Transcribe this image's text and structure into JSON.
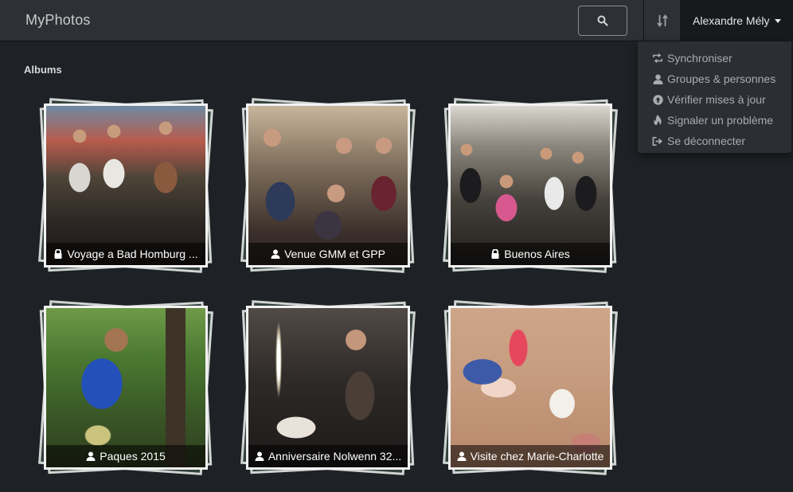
{
  "navbar": {
    "brand": "MyPhotos",
    "search_icon": "search-icon",
    "sort_icon": "sort-icon",
    "user_name": "Alexandre Mély"
  },
  "dropdown": {
    "items": [
      {
        "label": "Synchroniser",
        "icon": "sync-icon"
      },
      {
        "label": "Groupes & personnes",
        "icon": "user-icon"
      },
      {
        "label": "Vérifier mises à jour",
        "icon": "upload-circle-icon"
      },
      {
        "label": "Signaler un problème",
        "icon": "fire-icon"
      },
      {
        "label": "Se déconnecter",
        "icon": "logout-icon"
      }
    ]
  },
  "section_title": "Albums",
  "albums": [
    {
      "title": "Voyage a Bad Homburg ...",
      "icon": "lock-icon"
    },
    {
      "title": "Venue GMM et GPP",
      "icon": "user-icon"
    },
    {
      "title": "Buenos Aires",
      "icon": "lock-icon"
    },
    {
      "title": "Paques 2015",
      "icon": "user-icon"
    },
    {
      "title": "Anniversaire Nolwenn 32...",
      "icon": "user-icon"
    },
    {
      "title": "Visite chez Marie-Charlotte",
      "icon": "user-icon"
    }
  ],
  "colors": {
    "background": "#1e2125",
    "navbar": "#2d3034",
    "dropdown": "#2b2e32",
    "caption_text": "#ffffff"
  }
}
